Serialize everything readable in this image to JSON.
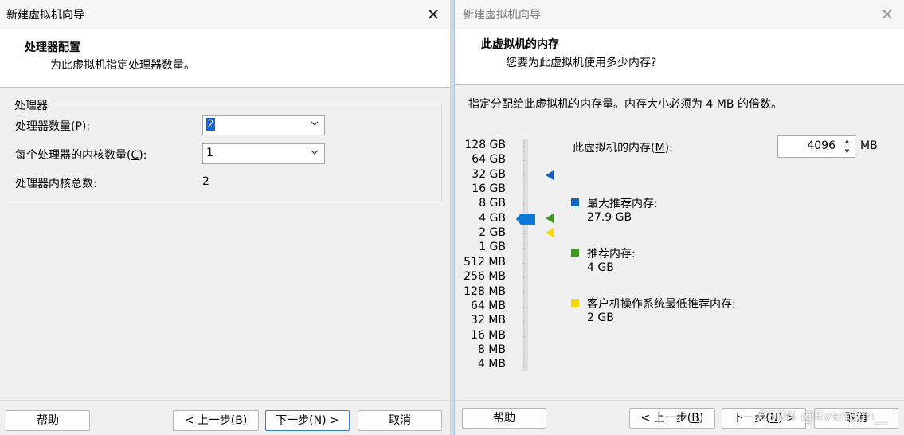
{
  "left_dialog": {
    "title": "新建虚拟机向导",
    "close_glyph": "✕",
    "header_title": "处理器配置",
    "header_subtitle": "为此虚拟机指定处理器数量。",
    "group_label": "处理器",
    "processor_count_label_pre": "处理器数量(",
    "processor_count_label_key": "P",
    "processor_count_label_post": "):",
    "processor_count_value": "2",
    "cores_label_pre": "每个处理器的内核数量(",
    "cores_label_key": "C",
    "cores_label_post": "):",
    "cores_value": "1",
    "total_cores_label": "处理器内核总数:",
    "total_cores_value": "2",
    "buttons": {
      "help": "帮助",
      "back_pre": "< 上一步(",
      "back_key": "B",
      "back_post": ")",
      "next_pre": "下一步(",
      "next_key": "N",
      "next_post": ") >",
      "cancel": "取消"
    }
  },
  "right_dialog": {
    "title": "新建虚拟机向导",
    "close_glyph": "✕",
    "header_title": "此虚拟机的内存",
    "header_subtitle": "您要为此虚拟机使用多少内存?",
    "info_text": "指定分配给此虚拟机的内存量。内存大小必须为 4 MB 的倍数。",
    "scale_labels": [
      "128 GB",
      "64 GB",
      "32 GB",
      "16 GB",
      "8 GB",
      "4 GB",
      "2 GB",
      "1 GB",
      "512 MB",
      "256 MB",
      "128 MB",
      "64 MB",
      "32 MB",
      "16 MB",
      "8 MB",
      "4 MB"
    ],
    "memory_label_pre": "此虚拟机的内存(",
    "memory_label_key": "M",
    "memory_label_post": "):",
    "memory_value": "4096",
    "memory_unit": "MB",
    "legend": [
      {
        "label": "最大推荐内存:",
        "value": "27.9 GB",
        "color": "#0a64c8"
      },
      {
        "label": "推荐内存:",
        "value": "4 GB",
        "color": "#3c9a1e"
      },
      {
        "label": "客户机操作系统最低推荐内存:",
        "value": "2 GB",
        "color": "#f5d800"
      }
    ],
    "buttons": {
      "help": "帮助",
      "back_pre": "< 上一步(",
      "back_key": "B",
      "back_post": ")",
      "next_pre": "下一步(",
      "next_key": "N",
      "next_post": ") >",
      "cancel": "取消"
    },
    "watermark": "CSDN @EvanSun__"
  }
}
